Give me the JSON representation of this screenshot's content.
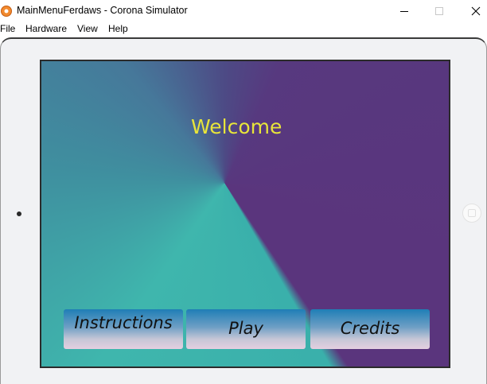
{
  "window": {
    "title": "MainMenuFerdaws - Corona Simulator",
    "icon": "corona-app-icon"
  },
  "menubar": {
    "items": [
      {
        "label": "File"
      },
      {
        "label": "Hardware"
      },
      {
        "label": "View"
      },
      {
        "label": "Help"
      }
    ]
  },
  "game": {
    "welcome_text": "Welcome",
    "welcome_color": "#e8e53a",
    "buttons": [
      {
        "label": "Instructions"
      },
      {
        "label": "Play"
      },
      {
        "label": "Credits"
      }
    ]
  }
}
